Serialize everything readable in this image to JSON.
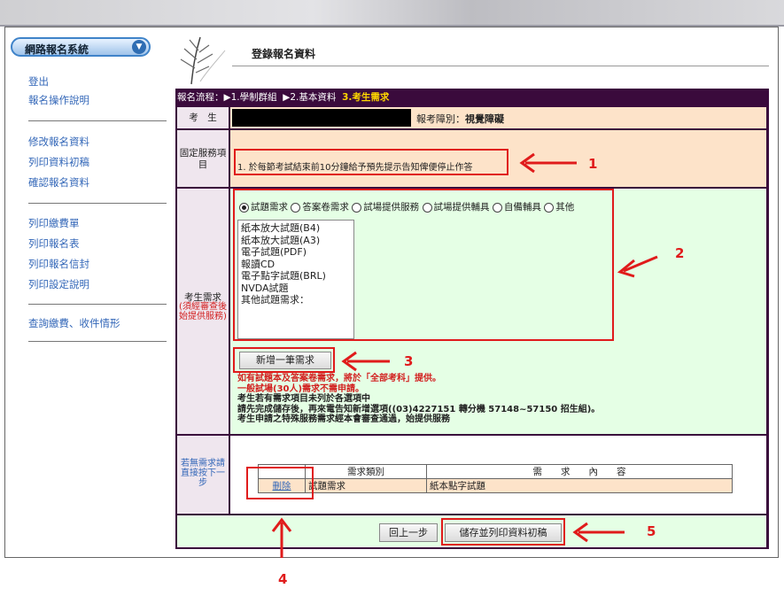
{
  "sidebar": {
    "system_label": "網路報名系統",
    "items_group1": [
      "登出",
      "報名操作說明"
    ],
    "items_group2": [
      "修改報名資料",
      "列印資料初稿",
      "確認報名資料"
    ],
    "items_group3": [
      "列印繳費單",
      "列印報名表",
      "列印報名信封",
      "列印設定說明"
    ],
    "items_group4": [
      "查詢繳費、收件情形"
    ]
  },
  "header": {
    "title": "登錄報名資料"
  },
  "flow": {
    "prefix": "報名流程：",
    "step1": "▶1.學制群組",
    "step2": "▶2.基本資料",
    "step3": "3.考生需求"
  },
  "examinee": {
    "label": "考　生",
    "disability_label": "報考障別：",
    "disability_value": "視覺障礙"
  },
  "fixed_service": {
    "label": "固定服務項目",
    "text": "1. 於每節考試結束前10分鐘給予預先提示告知俾便停止作答"
  },
  "needs": {
    "label": "考生需求",
    "label_note": "(須經審查後始提供服務)",
    "radios": [
      {
        "label": "試題需求",
        "checked": true
      },
      {
        "label": "答案卷需求",
        "checked": false
      },
      {
        "label": "試場提供服務",
        "checked": false
      },
      {
        "label": "試場提供輔具",
        "checked": false
      },
      {
        "label": "自備輔具",
        "checked": false
      },
      {
        "label": "其他",
        "checked": false
      }
    ],
    "options": [
      "紙本放大試題(B4)",
      "紙本放大試題(A3)",
      "電子試題(PDF)",
      "報讀CD",
      "電子點字試題(BRL)",
      "NVDA試題",
      "其他試題需求："
    ],
    "add_button": "新增一筆需求",
    "notes_red": [
      "如有試題本及答案卷需求，將於「全部考科」提供。",
      "一般試場(30人)需求不需申請。"
    ],
    "notes_black": [
      "考生若有需求項目未列於各選項中",
      "請先完成儲存後，再來電告知新增選項((03)4227151 轉分機 57148~57150 招生組)。",
      "考生申請之特殊服務需求經本會審查通過，始提供服務"
    ]
  },
  "no_need": {
    "label": "若無需求請直接按下一步"
  },
  "req_table": {
    "headers": [
      "需求類別",
      "需　　求　　內　　容"
    ],
    "rows": [
      {
        "action": "刪除",
        "category": "試題需求",
        "content": "紙本點字試題"
      }
    ]
  },
  "footer": {
    "back_button": "回上一步",
    "save_button": "儲存並列印資料初稿"
  },
  "annotations": [
    "1",
    "2",
    "3",
    "4",
    "5"
  ],
  "colors": {
    "annotation": "#e01b1b",
    "table_bg": "#3a0a3c",
    "peach": "#fde3c9",
    "green": "#e5ffe5",
    "link": "#3367b8"
  }
}
